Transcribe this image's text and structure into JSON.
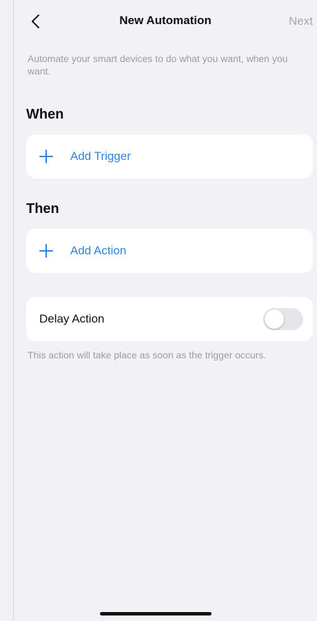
{
  "nav": {
    "title": "New Automation",
    "next_label": "Next"
  },
  "intro_text": "Automate your smart devices to do what you want, when you want.",
  "when": {
    "heading": "When",
    "add_trigger_label": "Add Trigger"
  },
  "then": {
    "heading": "Then",
    "add_action_label": "Add Action"
  },
  "delay": {
    "label": "Delay Action",
    "enabled": false
  },
  "footnote": "This action will take place as soon as the trigger occurs.",
  "colors": {
    "accent": "#2f82e0",
    "background": "#f2f2f6",
    "muted_text": "#9b9ba1"
  }
}
